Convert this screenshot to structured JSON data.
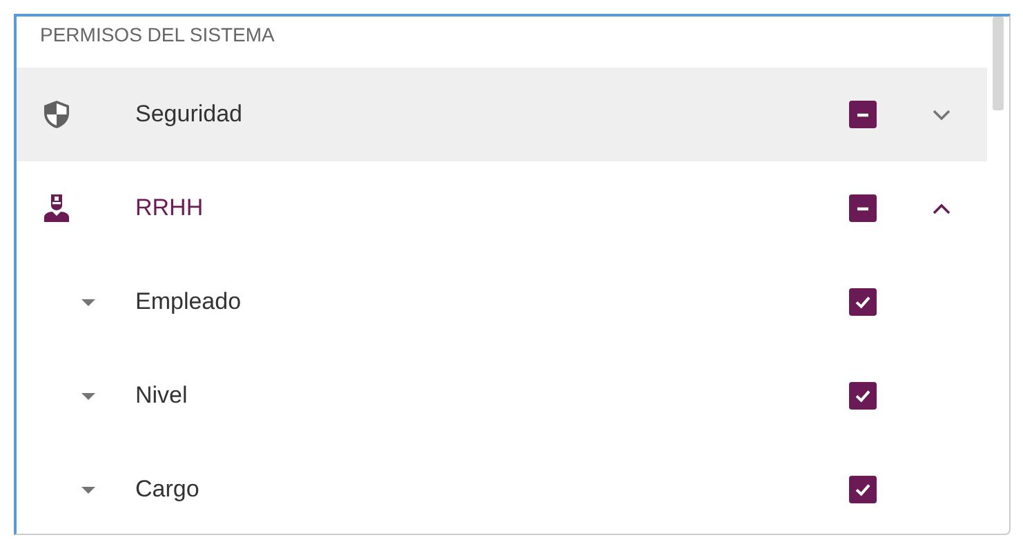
{
  "panel": {
    "title": "PERMISOS DEL SISTEMA",
    "groups": [
      {
        "label": "Seguridad",
        "highlighted": true,
        "expanded": false,
        "indeterminate": true
      },
      {
        "label": "RRHH",
        "highlighted": false,
        "expanded": true,
        "indeterminate": true,
        "children": [
          {
            "label": "Empleado",
            "checked": true
          },
          {
            "label": "Nivel",
            "checked": true
          },
          {
            "label": "Cargo",
            "checked": true
          }
        ]
      }
    ]
  }
}
